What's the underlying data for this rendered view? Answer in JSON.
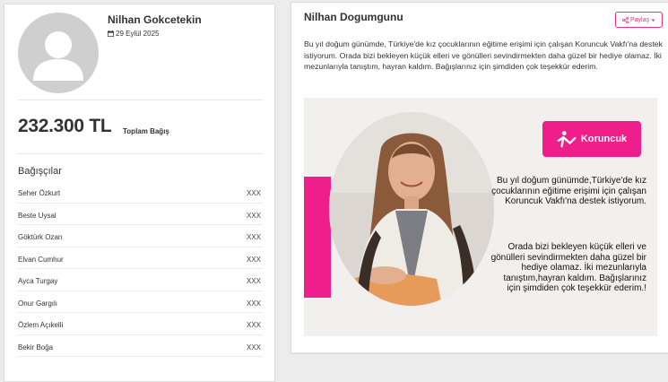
{
  "owner": {
    "name": "Nilhan Gokcetekin",
    "date": "29 Eylül 2025"
  },
  "donation": {
    "amount": "232.300 TL",
    "label": "Toplam Bağış"
  },
  "donors": {
    "title": "Bağışçılar",
    "items": [
      {
        "name": "Seher Özkurt",
        "amount": "XXX"
      },
      {
        "name": "Beste Uysal",
        "amount": "XXX"
      },
      {
        "name": "Göktürk Ozan",
        "amount": "XXX"
      },
      {
        "name": "Elvan Cumhur",
        "amount": "XXX"
      },
      {
        "name": "Ayca Turgay",
        "amount": "XXX"
      },
      {
        "name": "Onur Gargılı",
        "amount": "XXX"
      },
      {
        "name": "Özlem Açıkelli",
        "amount": "XXX"
      },
      {
        "name": "Bekir Boğa",
        "amount": "XXX"
      }
    ]
  },
  "campaign": {
    "title": "Nilhan Dogumgunu",
    "share_label": "Paylaş",
    "description": "Bu yıl doğum günümde, Türkiye'de kız çocuklarının eğitime erişimi için çalışan Koruncuk Vakfı'na destek istiyorum. Orada bizi bekleyen küçük elleri ve gönülleri sevindirmekten daha güzel bir hediye olamaz. İki mezunlarıyla tanıştım, hayran kaldım. Bağışlarınız için şimdiden çok teşekkür ederim.",
    "banner": {
      "logo": "Koruncuk",
      "text1": "Bu yıl doğum günümde,Türkiye'de kız çocuklarının eğitime erişimi için çalışan Koruncuk Vakfı'na destek istiyorum.",
      "text2": "Orada bizi bekleyen küçük elleri ve gönülleri sevindirmekten daha güzel bir hediye olamaz. İki mezunlarıyla tanıştım,hayran kaldım. Bağışlarınız için şimdiden çok teşekkür ederim.!"
    }
  },
  "colors": {
    "accent": "#e8317f",
    "brand_pink": "#ee1e8a"
  },
  "icons": {
    "avatar": "user-silhouette-icon",
    "date": "calendar-icon",
    "share": "share-icon",
    "caret": "caret-down-icon"
  }
}
